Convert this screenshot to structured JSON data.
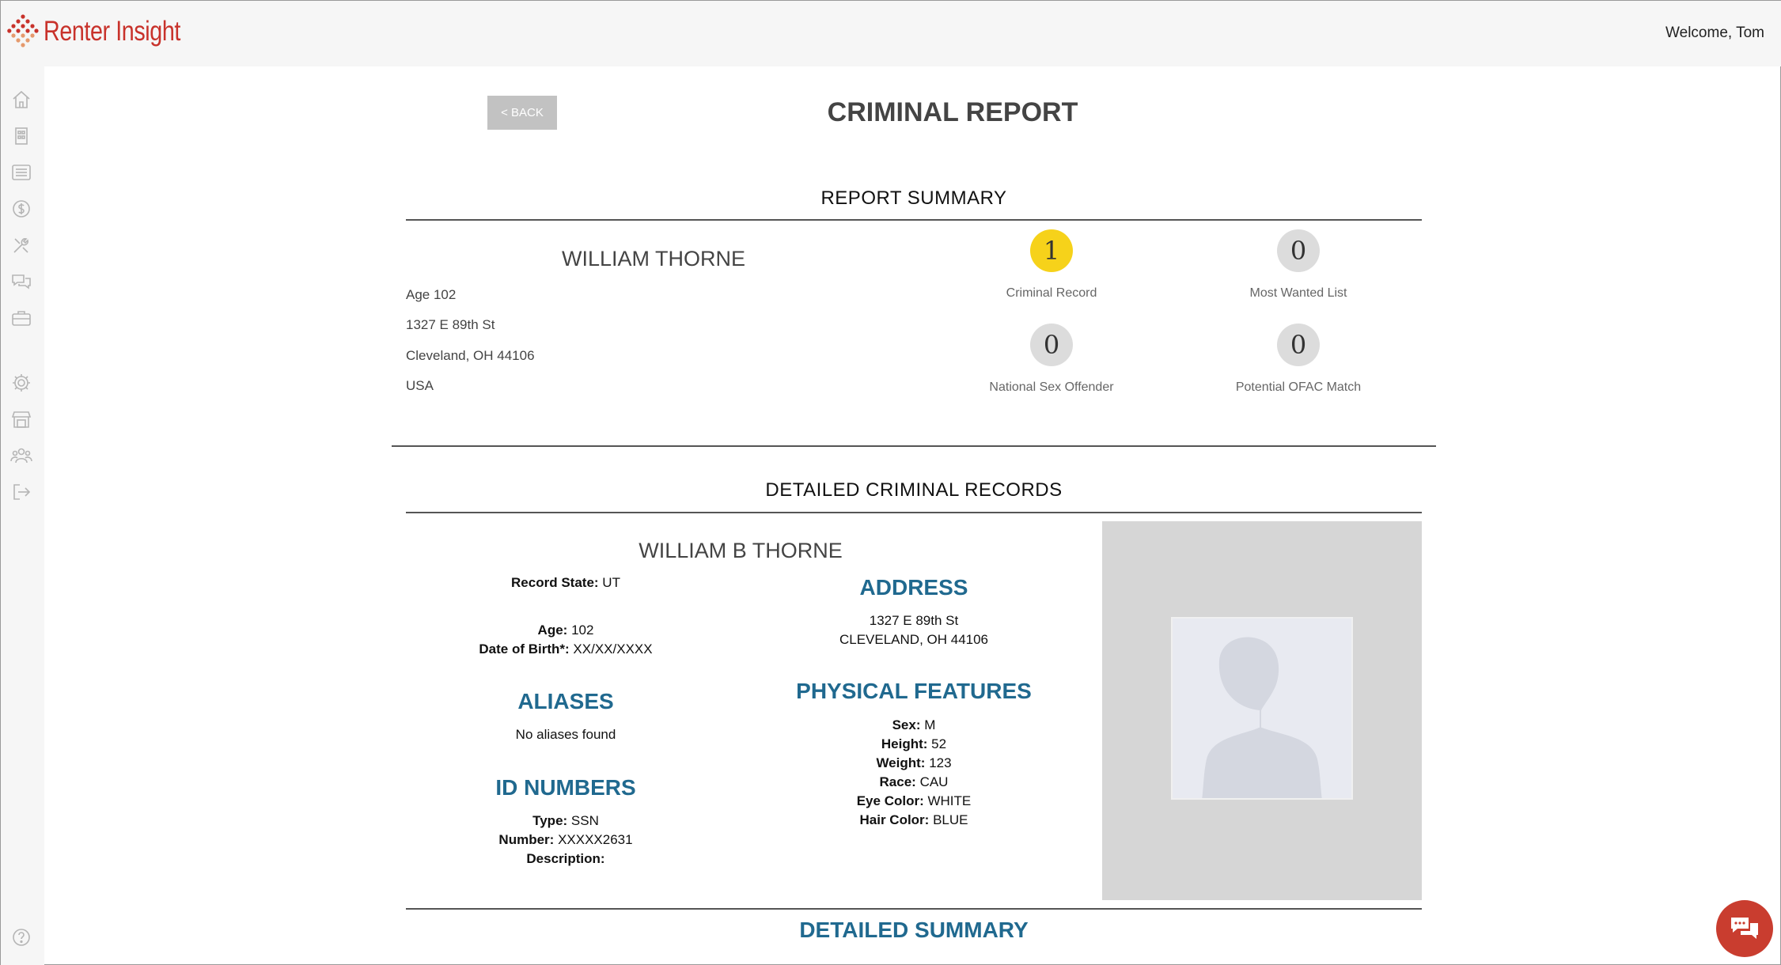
{
  "app": {
    "name": "Renter Insight",
    "welcome": "Welcome, Tom"
  },
  "sidebar": {
    "icons": [
      "home-icon",
      "building-icon",
      "list-icon",
      "dollar-icon",
      "tools-icon",
      "chat-icon",
      "briefcase-icon",
      "gear-icon",
      "storefront-icon",
      "users-icon",
      "logout-icon",
      "help-icon"
    ]
  },
  "page": {
    "back_label": "< BACK",
    "title": "CRIMINAL REPORT"
  },
  "summary": {
    "heading": "REPORT SUMMARY",
    "name": "WILLIAM THORNE",
    "age": "Age 102",
    "address1": "1327 E 89th St",
    "address2": "Cleveland, OH 44106",
    "country": "USA",
    "stats": [
      {
        "value": "1",
        "label": "Criminal Record",
        "alert": true
      },
      {
        "value": "0",
        "label": "Most Wanted List",
        "alert": false
      },
      {
        "value": "0",
        "label": "National Sex Offender",
        "alert": false
      },
      {
        "value": "0",
        "label": "Potential OFAC Match",
        "alert": false
      }
    ]
  },
  "detailed": {
    "heading": "DETAILED CRIMINAL RECORDS",
    "record_name": "WILLIAM B THORNE",
    "record_state_label": "Record State:",
    "record_state": "UT",
    "age_label": "Age:",
    "age": "102",
    "dob_label": "Date of Birth*:",
    "dob": "XX/XX/XXXX",
    "aliases_heading": "ALIASES",
    "aliases_text": "No aliases found",
    "id_heading": "ID NUMBERS",
    "id_type_label": "Type:",
    "id_type": "SSN",
    "id_number_label": "Number:",
    "id_number": "XXXXX2631",
    "id_desc_label": "Description:",
    "id_desc": "",
    "address_heading": "ADDRESS",
    "address_line1": "1327 E 89th St",
    "address_line2": "CLEVELAND, OH 44106",
    "physical_heading": "PHYSICAL FEATURES",
    "sex_label": "Sex:",
    "sex": "M",
    "height_label": "Height:",
    "height": "52",
    "weight_label": "Weight:",
    "weight": "123",
    "race_label": "Race:",
    "race": "CAU",
    "eye_label": "Eye Color:",
    "eye": "WHITE",
    "hair_label": "Hair Color:",
    "hair": "BLUE",
    "summary_heading": "DETAILED SUMMARY"
  },
  "colors": {
    "brand": "#c8322b",
    "accent_blue": "#20698f",
    "alert_yellow": "#f6d21a",
    "chat_red": "#c93d2f"
  }
}
